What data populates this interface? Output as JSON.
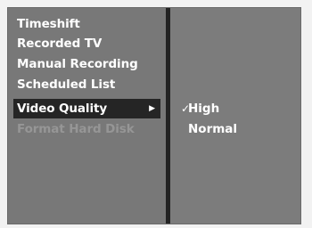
{
  "menu": {
    "items": [
      {
        "label": "Timeshift",
        "enabled": true,
        "selected": false
      },
      {
        "label": "Recorded TV",
        "enabled": true,
        "selected": false
      },
      {
        "label": "Manual Recording",
        "enabled": true,
        "selected": false
      },
      {
        "label": "Scheduled List",
        "enabled": true,
        "selected": false
      },
      {
        "label": "Video Quality",
        "enabled": true,
        "selected": true,
        "has_submenu": true
      },
      {
        "label": "Format Hard Disk",
        "enabled": false,
        "selected": false
      }
    ],
    "submenu_arrow": "▶"
  },
  "submenu": {
    "items": [
      {
        "label": "High",
        "checked": true
      },
      {
        "label": "Normal",
        "checked": false
      }
    ],
    "check_mark": "✓"
  },
  "colors": {
    "panel_background": "#7e7e7e",
    "highlight": "#252525",
    "text": "#ffffff",
    "disabled_text": "#969696",
    "divider": "#232323"
  }
}
